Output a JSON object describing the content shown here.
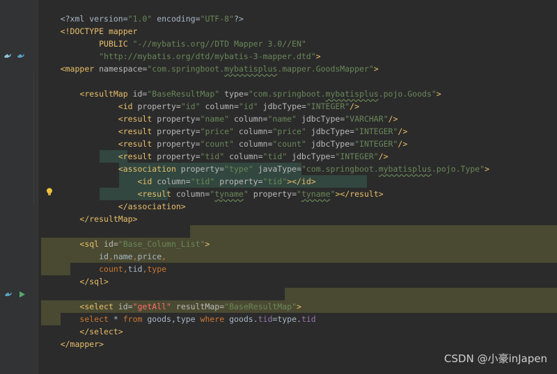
{
  "colors": {
    "background": "#2b2b2b",
    "gutter": "#313335",
    "tag": "#e8bf6a",
    "string": "#6a8759",
    "keyword": "#cc7832",
    "highlight_block": "#4a4a32",
    "highlight_assoc": "#32473f"
  },
  "code": {
    "l1": {
      "a": "<?xml version=",
      "b": "\"1.0\"",
      "c": " encoding=",
      "d": "\"UTF-8\"",
      "e": "?>"
    },
    "l2": {
      "a": "<!DOCTYPE mapper"
    },
    "l3": {
      "a": "        PUBLIC ",
      "b": "\"-//mybatis.org//DTD Mapper 3.0//EN\""
    },
    "l4": {
      "a": "        ",
      "b": "\"http://mybatis.org/dtd/mybatis-3-mapper.dtd\"",
      "c": ">"
    },
    "l5": {
      "a": "<mapper",
      "b": " namespace=",
      "c": "\"com.springboot.",
      "d": "mybatisplus",
      "e": ".mapper.GoodsMapper\"",
      "f": ">"
    },
    "l7": {
      "a": "    <resultMap",
      "b": " id=",
      "c": "\"BaseResultMap\"",
      "d": " type=",
      "e": "\"com.springboot.",
      "f": "mybatisplus",
      "g": ".pojo.Goods\"",
      "h": ">"
    },
    "l8": {
      "a": "            <id",
      "b": " property=",
      "c": "\"id\"",
      "d": " column=",
      "e": "\"id\"",
      "f": " jdbcType=",
      "g": "\"INTEGER\"",
      "h": "/>"
    },
    "l9": {
      "a": "            <result",
      "b": " property=",
      "c": "\"name\"",
      "d": " column=",
      "e": "\"name\"",
      "f": " jdbcType=",
      "g": "\"VARCHAR\"",
      "h": "/>"
    },
    "l10": {
      "a": "            <result",
      "b": " property=",
      "c": "\"price\"",
      "d": " column=",
      "e": "\"price\"",
      "f": " jdbcType=",
      "g": "\"INTEGER\"",
      "h": "/>"
    },
    "l11": {
      "a": "            <result",
      "b": " property=",
      "c": "\"count\"",
      "d": " column=",
      "e": "\"count\"",
      "f": " jdbcType=",
      "g": "\"INTEGER\"",
      "h": "/>"
    },
    "l12": {
      "a": "            <result",
      "b": " property=",
      "c": "\"tid\"",
      "d": " column=",
      "e": "\"tid\"",
      "f": " jdbcType=",
      "g": "\"INTEGER\"",
      "h": "/>"
    },
    "l13": {
      "a": "            <association",
      "b": " property=",
      "c": "\"type\"",
      "d": " javaType=",
      "e": "\"com.springboot.",
      "f": "mybatisplus",
      "g": ".pojo.Type\"",
      "h": ">"
    },
    "l14": {
      "a": "                <id",
      "b": " column=",
      "c": "\"tid\"",
      "d": " property=",
      "e": "\"tid\"",
      "f": "></id>"
    },
    "l15": {
      "a": "                <result",
      "b": " column=",
      "c": "\"",
      "d": "tyname",
      "e": "\"",
      "f": " property=",
      "g": "\"",
      "h": "tyname",
      "i": "\"",
      "j": "></result>"
    },
    "l16": {
      "a": "            </association>"
    },
    "l17": {
      "a": "    </resultMap>"
    },
    "l19": {
      "a": "    <sql",
      "b": " id=",
      "c": "\"Base_Column_List\"",
      "d": ">"
    },
    "l20": {
      "a": "        id",
      "b": ",",
      "c": "name",
      "d": ",",
      "e": "price",
      "f": ","
    },
    "l21": {
      "a": "        ",
      "b": "count",
      "c": ",",
      "d": "tid",
      "e": ",",
      "f": "type"
    },
    "l22": {
      "a": "    </sql>"
    },
    "l24": {
      "a": "    <select",
      "b": " id=",
      "c": "\"getAll\"",
      "d": " resultMap=",
      "e": "\"BaseResultMap\"",
      "f": ">"
    },
    "l25": {
      "a": "    select",
      "b": " * ",
      "c": "from",
      "d": " goods,type ",
      "e": "where",
      "f": " goods.",
      "g": "tid",
      "h": "=type.",
      "i": "tid"
    },
    "l26": {
      "a": "    </select>"
    },
    "l27": {
      "a": "</mapper>"
    }
  },
  "gutter_icons": [
    "mapper-bird-icon",
    "run-arrow-icon",
    "intention-bulb-icon"
  ],
  "watermark": "CSDN @小豪inJapen"
}
